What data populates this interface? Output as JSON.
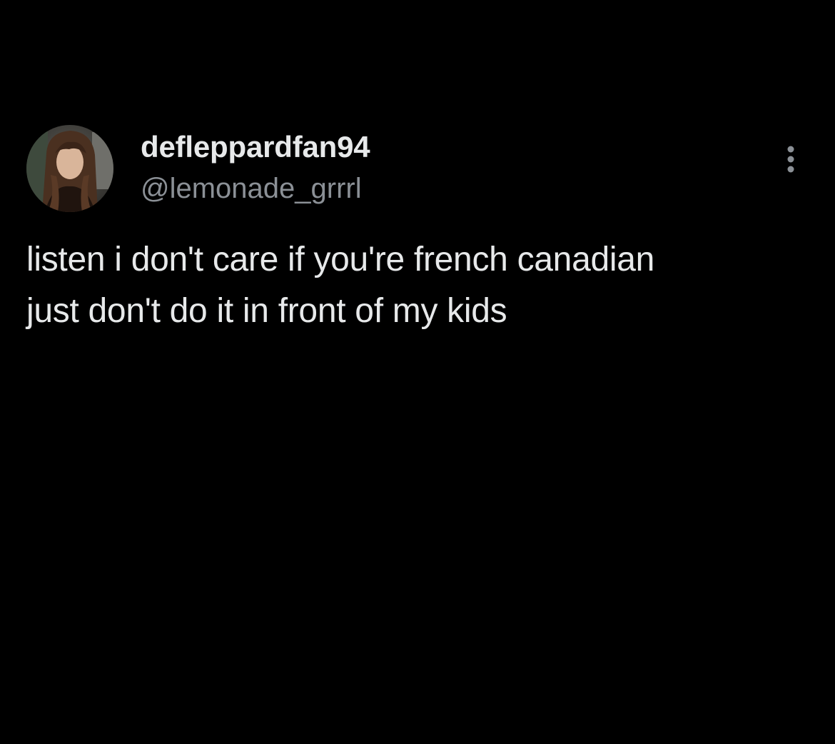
{
  "colors": {
    "background": "#000000",
    "primary_text": "#e7e9ea",
    "secondary_text": "#8b9096"
  },
  "author": {
    "avatar_icon": "user-photo-avatar",
    "display_name": "defleppardfan94",
    "handle": "@lemonade_grrrl"
  },
  "menu": {
    "more_icon": "vertical-ellipsis-icon"
  },
  "tweet": {
    "lines": [
      "listen i don't care if you're french canadian",
      "just don't do it in front of my kids"
    ]
  }
}
